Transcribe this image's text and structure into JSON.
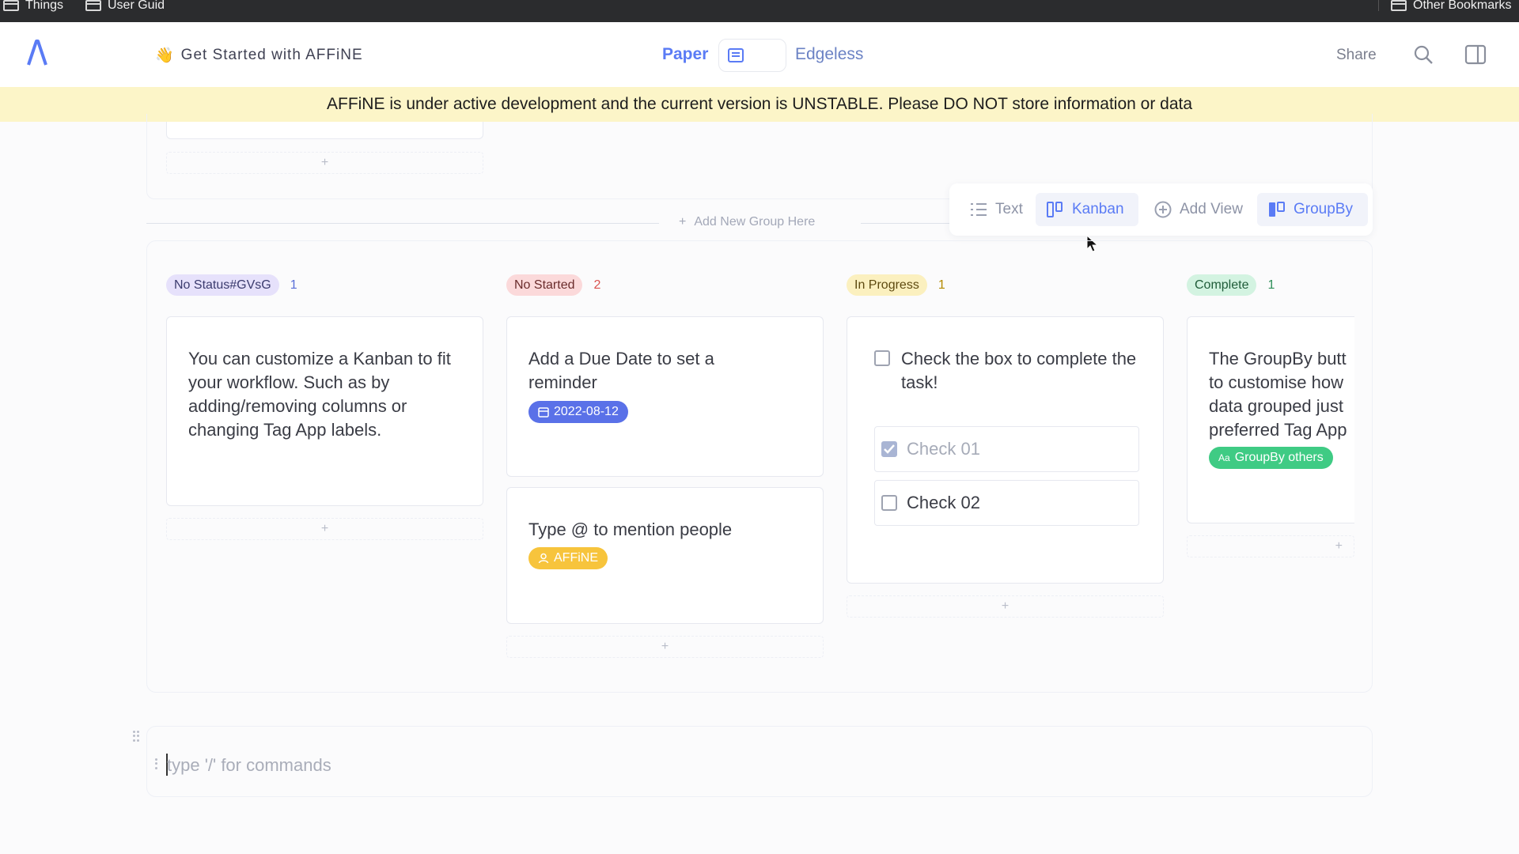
{
  "bookmarks": {
    "left": [
      "Things",
      "User Guid"
    ],
    "right": "Other Bookmarks"
  },
  "header": {
    "emoji": "👋",
    "title": "Get Started with AFFiNE",
    "mode_paper": "Paper",
    "mode_edgeless": "Edgeless",
    "share": "Share"
  },
  "banner": "AFFiNE is under active development and the current version is UNSTABLE. Please DO NOT store information or data",
  "add_symbol": "+",
  "add_group_label": "Add New Group Here",
  "view_bar": {
    "text": "Text",
    "kanban": "Kanban",
    "add_view": "Add View",
    "groupby": "GroupBy"
  },
  "columns": [
    {
      "label": "No Status#GVsG",
      "count": "1",
      "pill_bg": "#e6e1fb",
      "pill_fg": "#3b3b6e",
      "count_fg": "#5a6fd8",
      "cards": [
        {
          "text": "You can customize a Kanban to fit your workflow. Such as by adding/removing columns or changing Tag App labels."
        }
      ]
    },
    {
      "label": "No Started",
      "count": "2",
      "pill_bg": "#fbd9da",
      "pill_fg": "#6a2c2c",
      "count_fg": "#d9534f",
      "cards": [
        {
          "text": "Add a Due Date to set a reminder",
          "tag": "2022-08-12",
          "tag_color": "#5a71e8"
        },
        {
          "text": "Type @ to mention people",
          "tag": "AFFiNE",
          "tag_color": "#f7c43c"
        }
      ]
    },
    {
      "label": "In Progress",
      "count": "1",
      "pill_bg": "#fbf0bf",
      "pill_fg": "#5e4a10",
      "count_fg": "#b38a00",
      "cards": [
        {
          "text": "Check the box to complete the task!",
          "checks": [
            {
              "label": "Check 01",
              "checked": true
            },
            {
              "label": "Check 02",
              "checked": false
            }
          ]
        }
      ]
    },
    {
      "label": "Complete",
      "count": "1",
      "pill_bg": "#d3f3e1",
      "pill_fg": "#1f5c39",
      "count_fg": "#2f8f5a",
      "cards": [
        {
          "lines": [
            "The GroupBy butt",
            "to customise how",
            "data grouped just",
            "preferred Tag App"
          ],
          "tag": "GroupBy others",
          "tag_color": "#3fcb84"
        }
      ]
    }
  ],
  "editor": {
    "placeholder": "type '/' for commands"
  },
  "colors": {
    "accent": "#5a7bf5",
    "banner_bg": "#fcf5c8"
  }
}
